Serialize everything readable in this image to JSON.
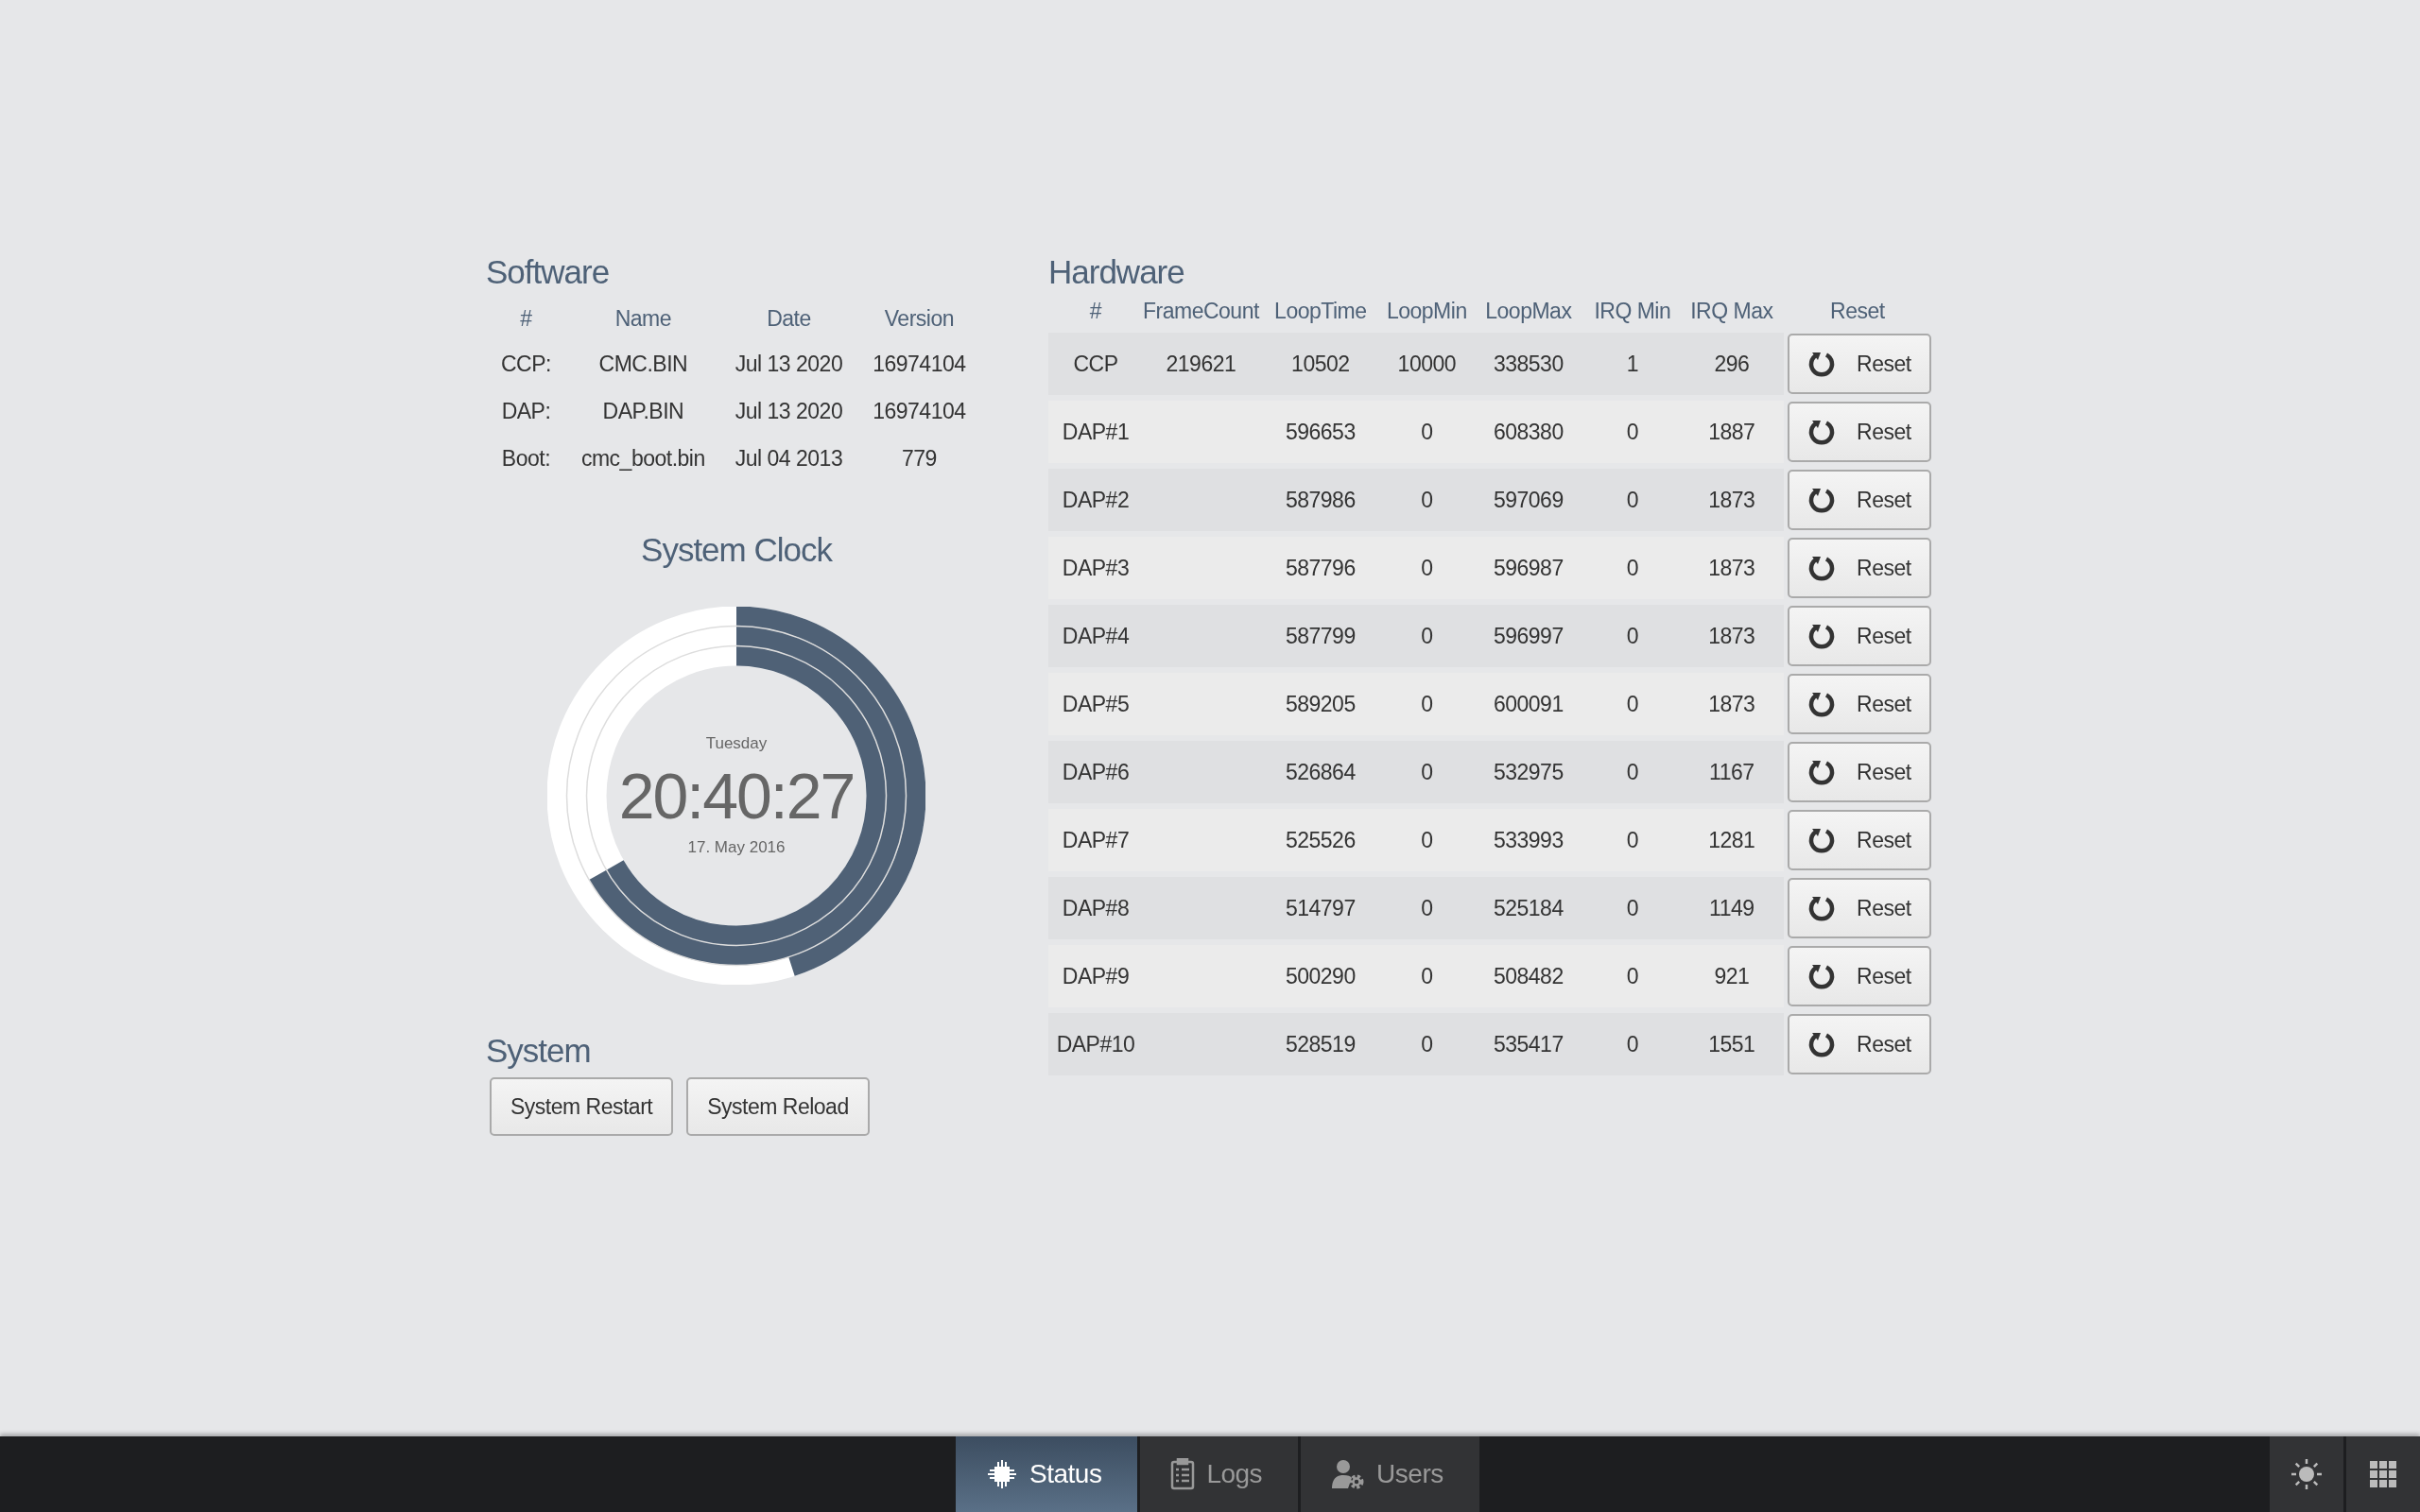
{
  "software": {
    "title": "Software",
    "columns": [
      "#",
      "Name",
      "Date",
      "Version"
    ],
    "rows": [
      [
        "CCP:",
        "CMC.BIN",
        "Jul 13 2020",
        "16974104"
      ],
      [
        "DAP:",
        "DAP.BIN",
        "Jul 13 2020",
        "16974104"
      ],
      [
        "Boot:",
        "cmc_boot.bin",
        "Jul 04 2013",
        "779"
      ]
    ]
  },
  "clock": {
    "title": "System Clock",
    "day": "Tuesday",
    "time": "20:40:27",
    "date": "17. May 2016",
    "rings": [
      {
        "kind": "seconds",
        "level": 0.45
      },
      {
        "kind": "minutes",
        "level": 0.667
      },
      {
        "kind": "hours",
        "level": 0.667
      }
    ]
  },
  "system": {
    "title": "System",
    "buttons": [
      "System Restart",
      "System Reload"
    ]
  },
  "hardware": {
    "title": "Hardware",
    "columns": [
      "#",
      "FrameCount",
      "LoopTime",
      "LoopMin",
      "LoopMax",
      "IRQ Min",
      "IRQ Max",
      "Reset"
    ],
    "rows": [
      {
        "name": "CCP",
        "frame_count": "219621",
        "loop_time": "10502",
        "loop_min": "10000",
        "loop_max": "338530",
        "irq_min": "1",
        "irq_max": "296",
        "button": "Reset"
      },
      {
        "name": "DAP#1",
        "loop_time": "596653",
        "loop_min": "0",
        "loop_max": "608380",
        "irq_min": "0",
        "irq_max": "1887",
        "button": "Reset"
      },
      {
        "name": "DAP#2",
        "loop_time": "587986",
        "loop_min": "0",
        "loop_max": "597069",
        "irq_min": "0",
        "irq_max": "1873",
        "button": "Reset"
      },
      {
        "name": "DAP#3",
        "loop_time": "587796",
        "loop_min": "0",
        "loop_max": "596987",
        "irq_min": "0",
        "irq_max": "1873",
        "button": "Reset"
      },
      {
        "name": "DAP#4",
        "loop_time": "587799",
        "loop_min": "0",
        "loop_max": "596997",
        "irq_min": "0",
        "irq_max": "1873",
        "button": "Reset"
      },
      {
        "name": "DAP#5",
        "loop_time": "589205",
        "loop_min": "0",
        "loop_max": "600091",
        "irq_min": "0",
        "irq_max": "1873",
        "button": "Reset"
      },
      {
        "name": "DAP#6",
        "loop_time": "526864",
        "loop_min": "0",
        "loop_max": "532975",
        "irq_min": "0",
        "irq_max": "1167",
        "button": "Reset"
      },
      {
        "name": "DAP#7",
        "loop_time": "525526",
        "loop_min": "0",
        "loop_max": "533993",
        "irq_min": "0",
        "irq_max": "1281",
        "button": "Reset"
      },
      {
        "name": "DAP#8",
        "loop_time": "514797",
        "loop_min": "0",
        "loop_max": "525184",
        "irq_min": "0",
        "irq_max": "1149",
        "button": "Reset"
      },
      {
        "name": "DAP#9",
        "loop_time": "500290",
        "loop_min": "0",
        "loop_max": "508482",
        "irq_min": "0",
        "irq_max": "921",
        "button": "Reset"
      },
      {
        "name": "DAP#10",
        "loop_time": "528519",
        "loop_min": "0",
        "loop_max": "535417",
        "irq_min": "0",
        "irq_max": "1551",
        "button": "Reset"
      }
    ]
  },
  "nav": {
    "tabs": [
      {
        "kind": "status",
        "label": "Status",
        "selected": true
      },
      {
        "kind": "logs",
        "label": "Logs",
        "selected": false
      },
      {
        "kind": "users",
        "label": "Users",
        "selected": false
      }
    ]
  }
}
